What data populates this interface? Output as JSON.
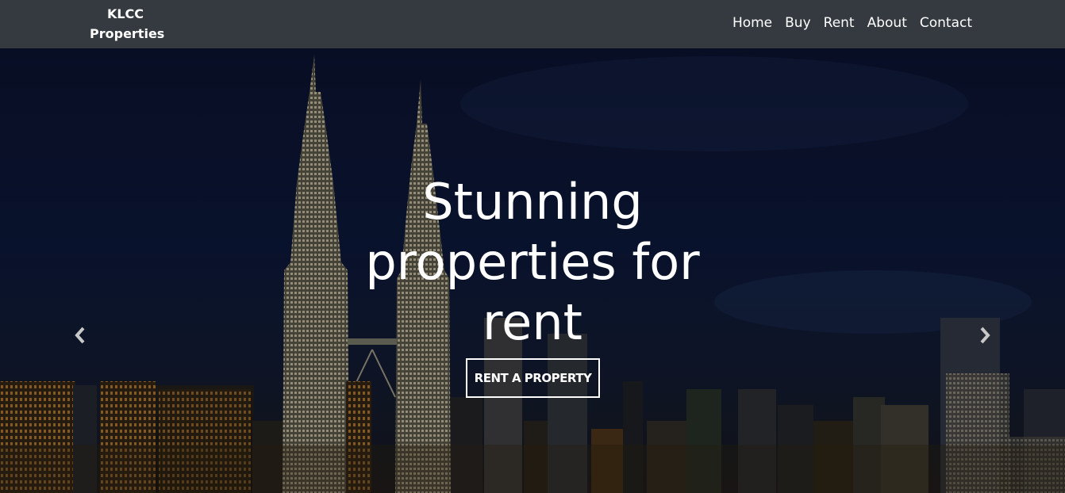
{
  "navbar": {
    "brand_line1": "KLCC",
    "brand_line2": "Properties",
    "links": [
      "Home",
      "Buy",
      "Rent",
      "About",
      "Contact"
    ]
  },
  "hero": {
    "title": "Stunning properties for rent",
    "cta_label": "RENT A PROPERTY"
  },
  "carousel": {
    "prev_icon": "chevron-left-icon",
    "next_icon": "chevron-right-icon"
  },
  "colors": {
    "navbar_bg": "#343a40",
    "text": "#ffffff",
    "sky": "#0f1d44"
  }
}
